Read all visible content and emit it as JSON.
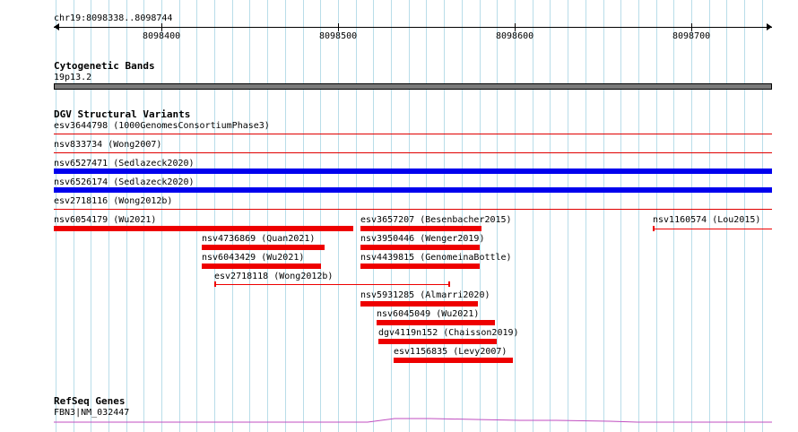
{
  "ruler": {
    "position": "chr19:8098338..8098744",
    "ticks": [
      "8098400",
      "8098500",
      "8098600",
      "8098700"
    ]
  },
  "cytoband": {
    "title": "Cytogenetic Bands",
    "band": "19p13.2",
    "band_color": "#7a7a7a"
  },
  "dgv": {
    "title": "DGV Structural Variants",
    "loss_color": "#ee0000",
    "gain_color": "#0000ee",
    "features": [
      {
        "label": "esv3644798 (1000GenomesConsortiumPhase3)"
      },
      {
        "label": "nsv833734 (Wong2007)"
      },
      {
        "label": "nsv6527471 (Sedlazeck2020)"
      },
      {
        "label": "nsv6526174 (Sedlazeck2020)"
      },
      {
        "label": "esv2718116 (Wong2012b)"
      },
      {
        "label": "nsv6054179 (Wu2021)"
      },
      {
        "label": "esv3657207 (Besenbacher2015)"
      },
      {
        "label": "nsv1160574 (Lou2015)"
      },
      {
        "label": "nsv4736869 (Quan2021)"
      },
      {
        "label": "nsv3950446 (Wenger2019)"
      },
      {
        "label": "nsv6043429 (Wu2021)"
      },
      {
        "label": "nsv4439815 (GenomeinaBottle)"
      },
      {
        "label": "esv2718118 (Wong2012b)"
      },
      {
        "label": "nsv5931285 (Almarri2020)"
      },
      {
        "label": "nsv6045049 (Wu2021)"
      },
      {
        "label": "dgv4119n152 (Chaisson2019)"
      },
      {
        "label": "esv1156835 (Levy2007)"
      }
    ]
  },
  "refseq": {
    "title": "RefSeq Genes",
    "gene": "FBN3|NM_032447",
    "color": "#c04ec0"
  }
}
